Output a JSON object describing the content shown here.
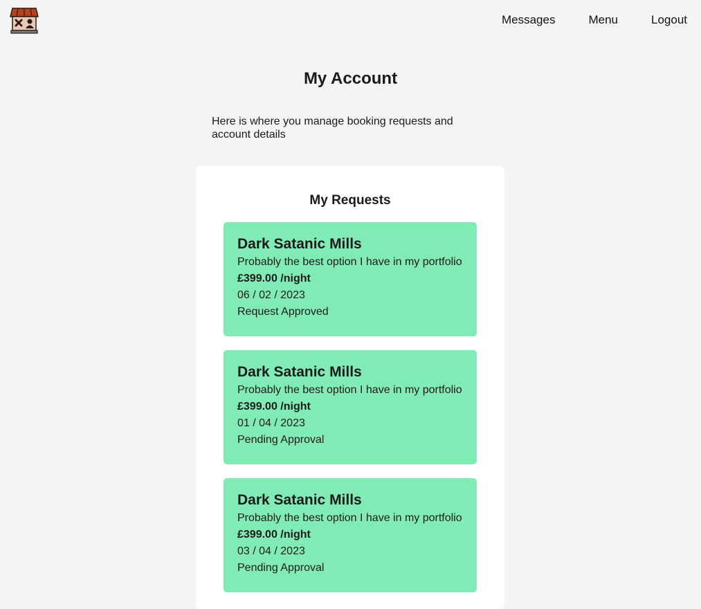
{
  "nav": {
    "links": [
      {
        "label": "Messages"
      },
      {
        "label": "Menu"
      },
      {
        "label": "Logout"
      }
    ]
  },
  "page": {
    "title": "My Account",
    "intro": "Here is where you manage booking requests and account details"
  },
  "requests_panel": {
    "title": "My Requests",
    "items": [
      {
        "name": "Dark Satanic Mills",
        "description": "Probably the best option I have in my portfolio",
        "price": "£399.00 /night",
        "date": "06 / 02 / 2023",
        "status": "Request Approved"
      },
      {
        "name": "Dark Satanic Mills",
        "description": "Probably the best option I have in my portfolio",
        "price": "£399.00 /night",
        "date": "01 / 04 / 2023",
        "status": "Pending Approval"
      },
      {
        "name": "Dark Satanic Mills",
        "description": "Probably the best option I have in my portfolio",
        "price": "£399.00 /night",
        "date": "03 / 04 / 2023",
        "status": "Pending Approval"
      }
    ]
  },
  "colors": {
    "background": "#f4f4f4",
    "panel": "#ffffff",
    "card": "#80ebb5"
  }
}
